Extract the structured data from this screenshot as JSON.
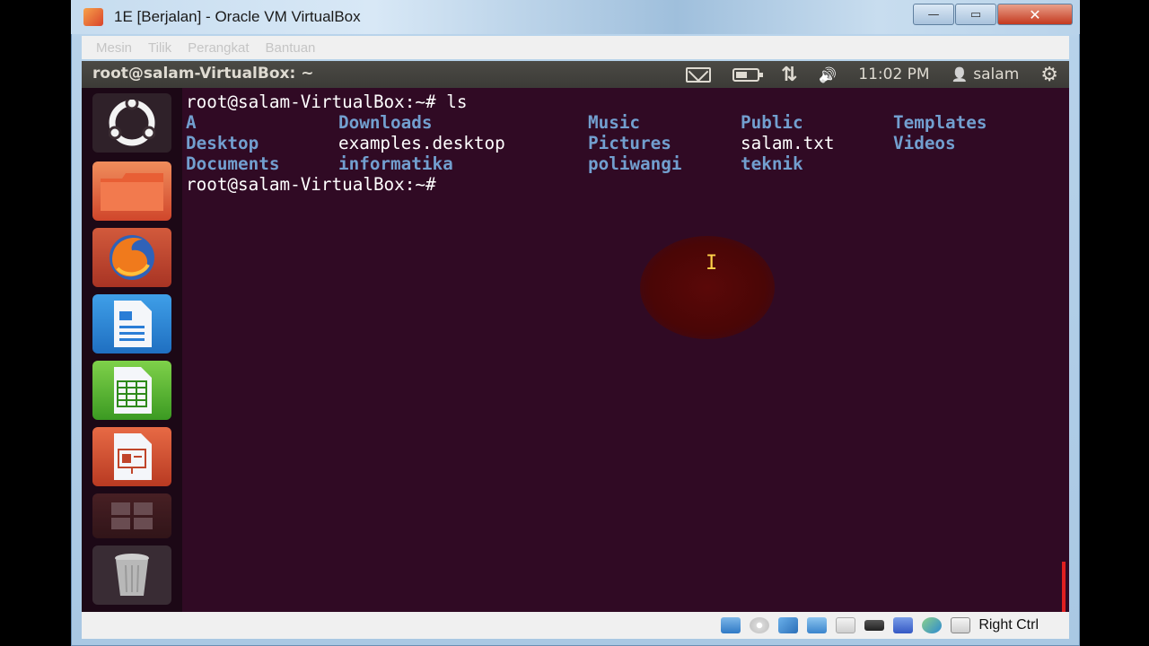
{
  "window": {
    "title": "1E [Berjalan] - Oracle VM VirtualBox",
    "minimize_glyph": "—",
    "maximize_glyph": "▭",
    "close_glyph": "✕"
  },
  "menubar": {
    "items": [
      "Mesin",
      "Tilik",
      "Perangkat",
      "Bantuan"
    ]
  },
  "guest_panel": {
    "title": "root@salam-VirtualBox: ~",
    "indicators": {
      "clock": "11:02 PM",
      "user": "salam",
      "transfer_glyph": "⇅",
      "volume_glyph": "🔊",
      "user_glyph": "👤",
      "gear_glyph": "⚙"
    }
  },
  "launcher": {
    "items": [
      {
        "name": "ubuntu-dash-icon"
      },
      {
        "name": "files-folder-icon"
      },
      {
        "name": "firefox-icon"
      },
      {
        "name": "libreoffice-writer-icon"
      },
      {
        "name": "libreoffice-calc-icon"
      },
      {
        "name": "libreoffice-impress-icon"
      },
      {
        "name": "workspace-switcher-icon"
      },
      {
        "name": "trash-icon"
      }
    ]
  },
  "terminal": {
    "command_line": "root@salam-VirtualBox:~# ls",
    "prompt_line": "root@salam-VirtualBox:~# ",
    "ls_rows": [
      [
        {
          "t": "A",
          "dir": true
        },
        {
          "t": "Downloads",
          "dir": true
        },
        {
          "t": "Music",
          "dir": true
        },
        {
          "t": "Public",
          "dir": true
        },
        {
          "t": "Templates",
          "dir": true
        }
      ],
      [
        {
          "t": "Desktop",
          "dir": true
        },
        {
          "t": "examples.desktop",
          "dir": false
        },
        {
          "t": "Pictures",
          "dir": true
        },
        {
          "t": "salam.txt",
          "dir": false
        },
        {
          "t": "Videos",
          "dir": true
        }
      ],
      [
        {
          "t": "Documents",
          "dir": true
        },
        {
          "t": "informatika",
          "dir": true
        },
        {
          "t": "poliwangi",
          "dir": true
        },
        {
          "t": "teknik",
          "dir": true
        },
        {
          "t": "",
          "dir": false
        }
      ]
    ],
    "cursor_glyph": "I"
  },
  "statusbar": {
    "host_key": "Right Ctrl"
  },
  "colors": {
    "terminal_bg": "#300a24",
    "dir_color": "#729fcf",
    "panel_bg": "#3c3b37"
  }
}
